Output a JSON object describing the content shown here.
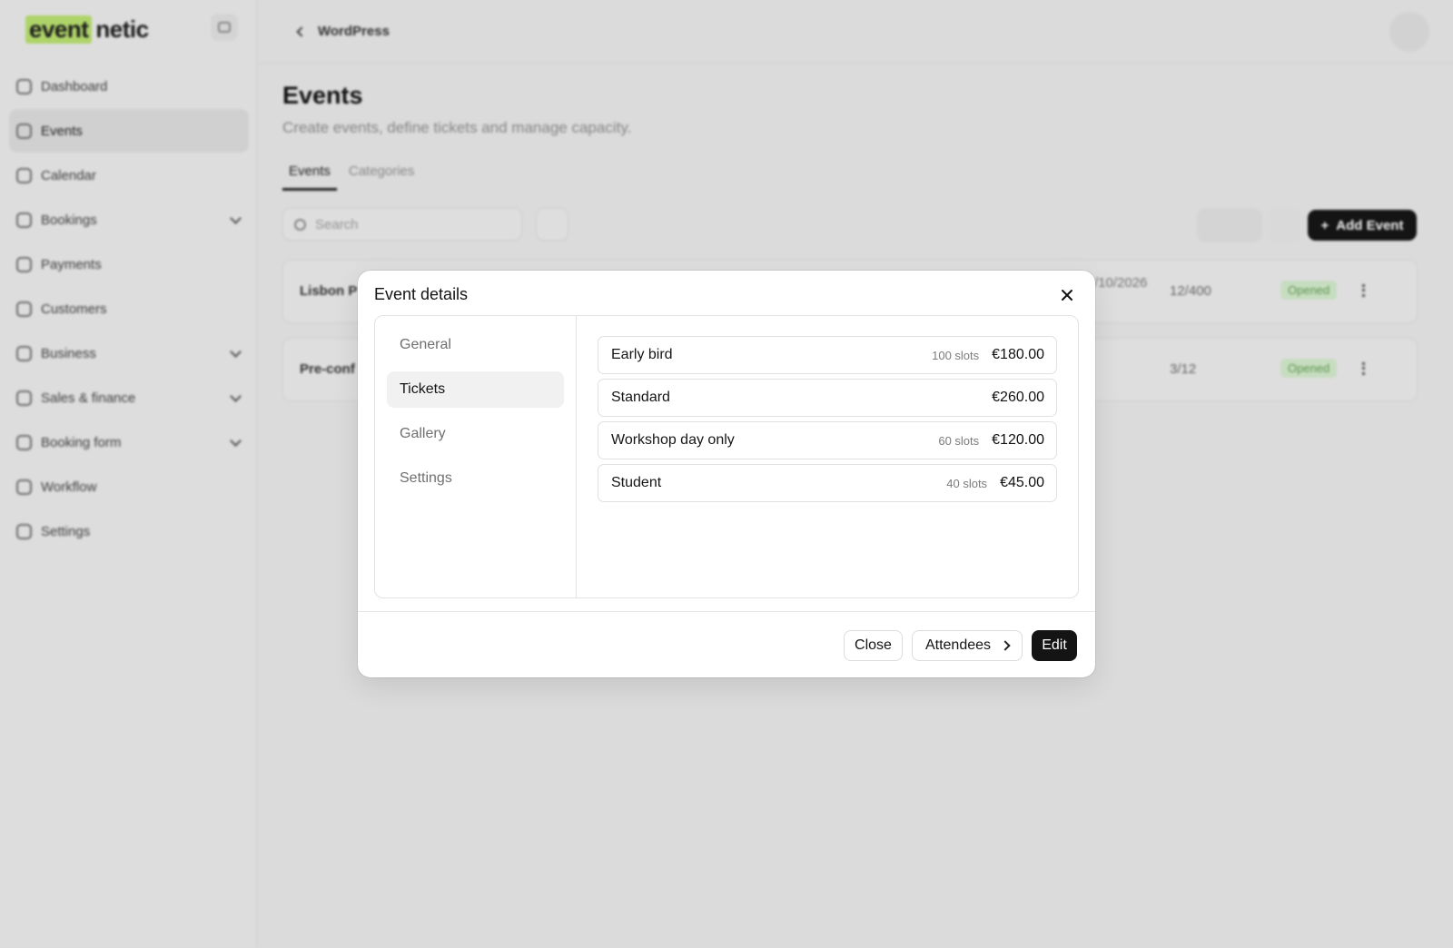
{
  "app": {
    "logo": {
      "highlight": "event",
      "rest": "netic"
    },
    "sidebar": {
      "items": [
        {
          "label": "Dashboard",
          "icon": "dashboard-icon"
        },
        {
          "label": "Events",
          "icon": "events-icon",
          "active": true
        },
        {
          "label": "Calendar",
          "icon": "calendar-icon"
        },
        {
          "label": "Bookings",
          "icon": "bookings-icon",
          "expandable": true
        },
        {
          "label": "Payments",
          "icon": "payments-icon"
        },
        {
          "label": "Customers",
          "icon": "customers-icon"
        },
        {
          "label": "Business",
          "icon": "business-icon",
          "expandable": true
        },
        {
          "label": "Sales & finance",
          "icon": "sales-icon",
          "expandable": true
        },
        {
          "label": "Booking form",
          "icon": "booking-form-icon",
          "expandable": true
        },
        {
          "label": "Workflow",
          "icon": "workflow-icon"
        },
        {
          "label": "Settings",
          "icon": "settings-icon"
        }
      ]
    },
    "topbar": {
      "back_label": "WordPress"
    },
    "page": {
      "title": "Events",
      "subtitle": "Create events, define tickets and manage capacity.",
      "tabs": [
        "Events",
        "Categories"
      ],
      "search_placeholder": "Search",
      "add_button": "Add Event"
    },
    "rows": [
      {
        "name": "Lisbon P",
        "date": "/10/2026",
        "capacity": "12/400",
        "status": "Opened"
      },
      {
        "name": "Pre-conf",
        "date": "",
        "capacity": "3/12",
        "status": "Opened"
      }
    ],
    "colors": {
      "accent_highlight": "#b6dd6e",
      "primary_button": "#141414",
      "status_green": "#5f9a50"
    }
  },
  "modal": {
    "title": "Event details",
    "nav": [
      {
        "label": "General"
      },
      {
        "label": "Tickets",
        "active": true
      },
      {
        "label": "Gallery"
      },
      {
        "label": "Settings"
      }
    ],
    "tickets": [
      {
        "name": "Early bird",
        "slots": "100 slots",
        "price": "€180.00"
      },
      {
        "name": "Standard",
        "slots": "",
        "price": "€260.00"
      },
      {
        "name": "Workshop day only",
        "slots": "60 slots",
        "price": "€120.00"
      },
      {
        "name": "Student",
        "slots": "40 slots",
        "price": "€45.00"
      }
    ],
    "footer": {
      "close_label": "Close",
      "attendees_label": "Attendees",
      "edit_label": "Edit"
    }
  }
}
